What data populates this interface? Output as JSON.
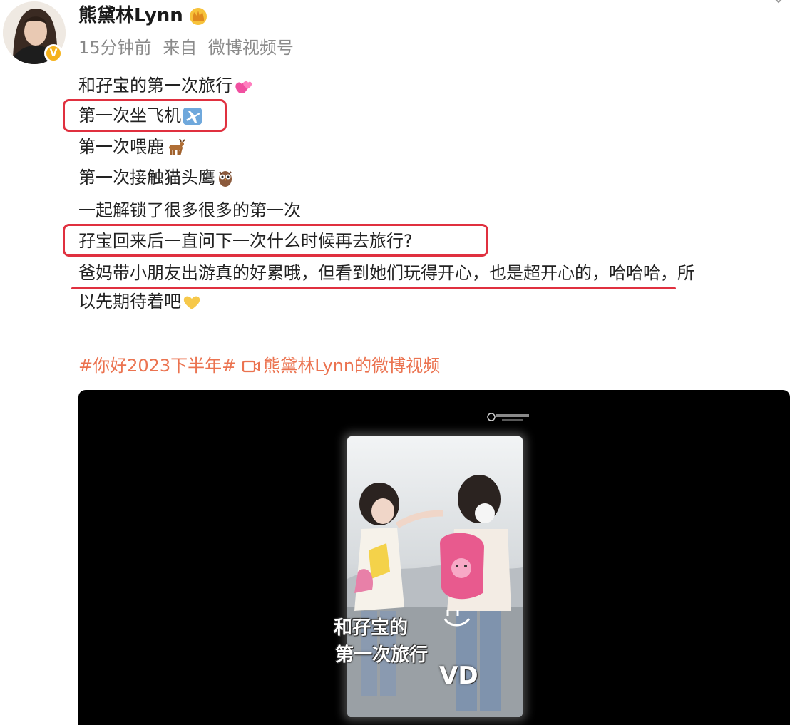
{
  "post": {
    "username": "熊黛林Lynn",
    "time": "15分钟前",
    "source_prefix": "来自",
    "source": "微博视频号",
    "lines": {
      "l1": "和孖宝的第一次旅行",
      "l2": "第一次坐飞机",
      "l3": "第一次喂鹿",
      "l4": "第一次接触猫头鹰",
      "l5": "一起解锁了很多很多的第一次",
      "l6": "孖宝回来后一直问下一次什么时候再去旅行?",
      "l7": "爸妈带小朋友出游真的好累哦，但看到她们玩得开心，也是超开心的，哈哈哈，所",
      "l8": "以先期待着吧"
    },
    "topic": "#你好2023下半年#",
    "video_link": "熊黛林Lynn的微博视频"
  },
  "video": {
    "caption_line1": "和孖宝的",
    "caption_line2": "第一次旅行",
    "caption_line3": "VD"
  },
  "colors": {
    "highlight_red": "#e0303f",
    "link_orange": "#eb7350",
    "verified_gold": "#f5b21c"
  },
  "icons": [
    "verified-badge-icon",
    "crown-icon",
    "heart-icon",
    "airplane-icon",
    "deer-icon",
    "owl-icon",
    "yellow-heart-icon",
    "video-icon"
  ]
}
